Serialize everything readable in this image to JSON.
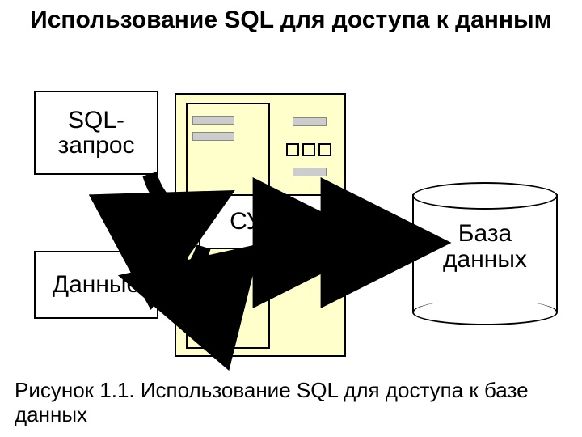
{
  "title": "Использование SQL для доступа к данным",
  "nodes": {
    "sql_query": "SQL-\nзапрос",
    "data": "Данные",
    "dbms": "СУБД",
    "database": "База\nданных"
  },
  "caption": "Рисунок 1.1. Использование SQL для доступа к базе данных"
}
